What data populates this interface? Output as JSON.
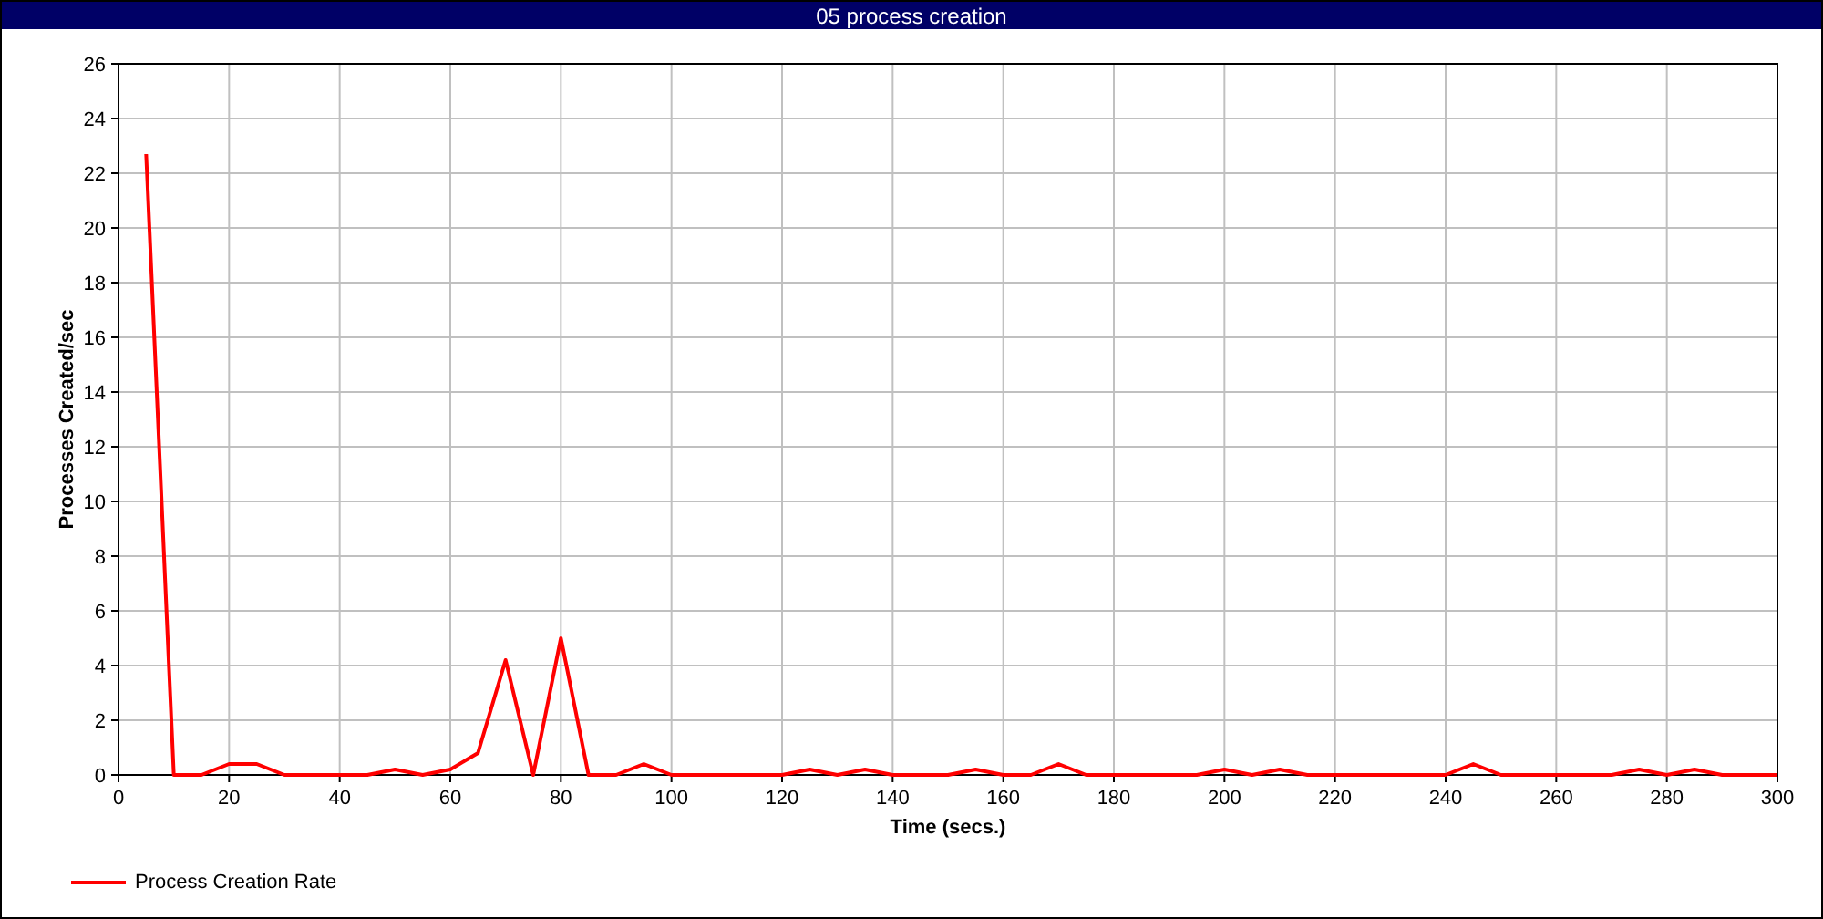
{
  "window": {
    "title": "05 process creation"
  },
  "chart_data": {
    "type": "line",
    "grid": true,
    "xlabel": "Time (secs.)",
    "ylabel": "Processes Created/sec",
    "xlim": [
      0,
      300
    ],
    "ylim": [
      0,
      26
    ],
    "xticks": [
      0,
      20,
      40,
      60,
      80,
      100,
      120,
      140,
      160,
      180,
      200,
      220,
      240,
      260,
      280,
      300
    ],
    "yticks": [
      0,
      2,
      4,
      6,
      8,
      10,
      12,
      14,
      16,
      18,
      20,
      22,
      24,
      26
    ],
    "x": [
      5,
      10,
      15,
      20,
      25,
      30,
      35,
      40,
      45,
      50,
      55,
      60,
      65,
      70,
      75,
      80,
      85,
      90,
      95,
      100,
      105,
      110,
      115,
      120,
      125,
      130,
      135,
      140,
      145,
      150,
      155,
      160,
      165,
      170,
      175,
      180,
      185,
      190,
      195,
      200,
      205,
      210,
      215,
      220,
      225,
      230,
      235,
      240,
      245,
      250,
      255,
      260,
      265,
      270,
      275,
      280,
      285,
      290,
      295,
      300
    ],
    "series": [
      {
        "name": "Process Creation Rate",
        "color": "#ff0000",
        "values": [
          22.7,
          0,
          0,
          0.4,
          0.4,
          0,
          0,
          0,
          0,
          0.2,
          0,
          0.2,
          0.8,
          4.2,
          0,
          5.0,
          0,
          0,
          0.4,
          0,
          0,
          0,
          0,
          0,
          0.2,
          0,
          0.2,
          0,
          0,
          0,
          0.2,
          0,
          0,
          0.4,
          0,
          0,
          0,
          0,
          0,
          0.2,
          0,
          0.2,
          0,
          0,
          0,
          0,
          0,
          0,
          0.4,
          0,
          0,
          0,
          0,
          0,
          0.2,
          0,
          0.2,
          0,
          0,
          0
        ]
      }
    ]
  }
}
